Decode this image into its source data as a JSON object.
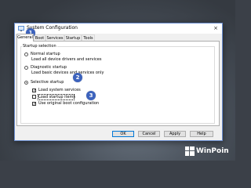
{
  "window": {
    "title": "System Configuration",
    "close_glyph": "×",
    "icon": "system-config-icon"
  },
  "tabs": [
    {
      "label": "General",
      "active": true
    },
    {
      "label": "Boot",
      "active": false
    },
    {
      "label": "Services",
      "active": false
    },
    {
      "label": "Startup",
      "active": false
    },
    {
      "label": "Tools",
      "active": false
    }
  ],
  "startup_selection": {
    "legend": "Startup selection",
    "normal": {
      "label": "Normal startup",
      "description": "Load all device drivers and services",
      "selected": false
    },
    "diagnostic": {
      "label": "Diagnostic startup",
      "description": "Load basic devices and services only",
      "selected": false
    },
    "selective": {
      "label": "Selective startup",
      "selected": true,
      "options": [
        {
          "label": "Load system services",
          "checked": true
        },
        {
          "label": "Load startup items",
          "checked": false
        },
        {
          "label": "Use original boot configuration",
          "checked": true
        }
      ]
    }
  },
  "buttons": {
    "ok": "OK",
    "cancel": "Cancel",
    "apply": "Apply",
    "help": "Help"
  },
  "annotations": [
    "1",
    "2",
    "3"
  ],
  "watermark": {
    "text": "WinPoin"
  },
  "colors": {
    "badge": "#3d63bd",
    "accent": "#0078d7"
  }
}
